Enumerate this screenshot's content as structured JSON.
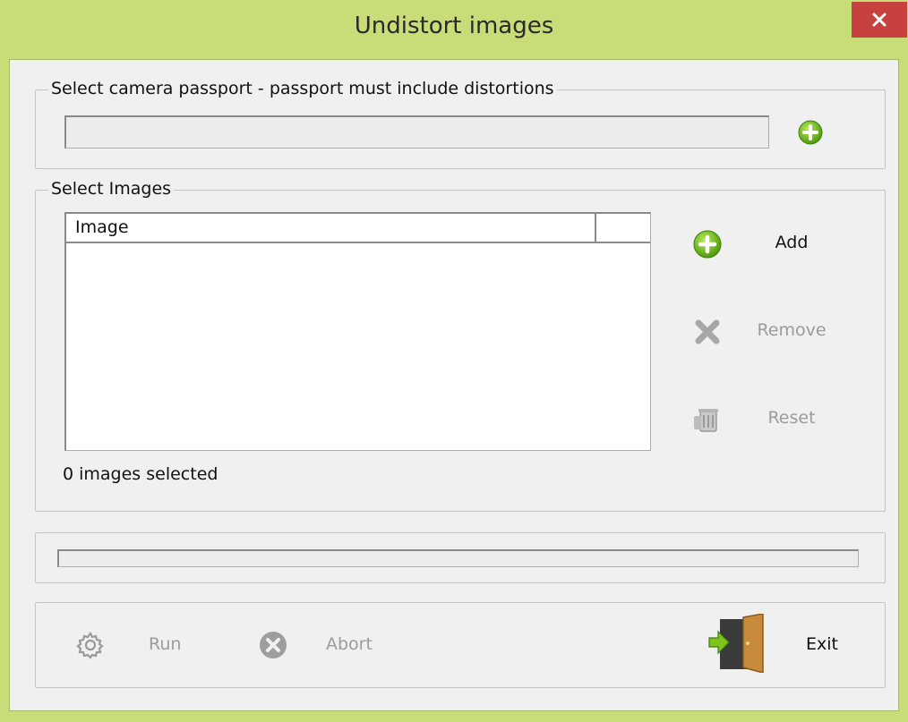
{
  "window": {
    "title": "Undistort images",
    "close_icon": "close-icon"
  },
  "passport": {
    "group_label": "Select camera passport - passport must include distortions",
    "value": "",
    "add_icon": "plus-circle-icon"
  },
  "images": {
    "group_label": "Select Images",
    "columns": [
      "Image",
      ""
    ],
    "rows": [],
    "count_text": "0 images selected",
    "buttons": {
      "add": {
        "label": "Add",
        "icon": "plus-circle-icon",
        "enabled": true
      },
      "remove": {
        "label": "Remove",
        "icon": "x-icon",
        "enabled": false
      },
      "reset": {
        "label": "Reset",
        "icon": "trash-icon",
        "enabled": false
      }
    }
  },
  "progress": {
    "value": 0
  },
  "actions": {
    "run": {
      "label": "Run",
      "icon": "gear-icon",
      "enabled": false
    },
    "abort": {
      "label": "Abort",
      "icon": "abort-icon",
      "enabled": false
    },
    "exit": {
      "label": "Exit",
      "icon": "exit-door-icon",
      "enabled": true
    }
  },
  "colors": {
    "frame": "#c8dc78",
    "close_button": "#c7423f",
    "client_background": "#f0f0f0",
    "accent_green": "#7cc31e",
    "disabled_text": "#9b9b9b"
  }
}
